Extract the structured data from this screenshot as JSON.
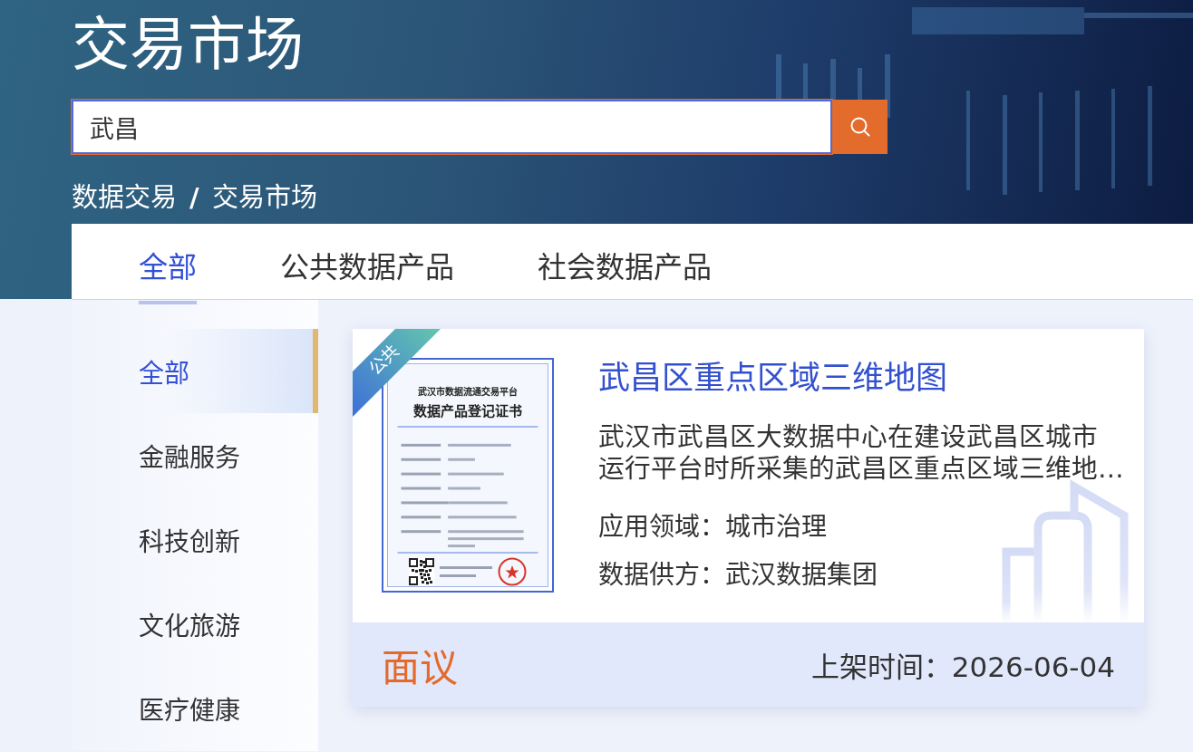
{
  "header": {
    "title": "交易市场",
    "search": {
      "value": "武昌"
    },
    "breadcrumb": {
      "items": [
        "数据交易",
        "交易市场"
      ],
      "separator": "/"
    }
  },
  "tabs": [
    {
      "label": "全部",
      "selected": true
    },
    {
      "label": "公共数据产品",
      "selected": false
    },
    {
      "label": "社会数据产品",
      "selected": false
    }
  ],
  "sidebar": {
    "items": [
      {
        "label": "全部",
        "selected": true
      },
      {
        "label": "金融服务",
        "selected": false
      },
      {
        "label": "科技创新",
        "selected": false
      },
      {
        "label": "文化旅游",
        "selected": false
      },
      {
        "label": "医疗健康",
        "selected": false
      }
    ]
  },
  "products": [
    {
      "tag": "公共",
      "certificate": {
        "issuer": "武汉市数据流通交易平台",
        "title": "数据产品登记证书"
      },
      "title": "武昌区重点区域三维地图",
      "description": "武汉市武昌区大数据中心在建设武昌区城市运行平台时所采集的武昌区重点区域三维地…",
      "fields": [
        {
          "label": "应用领域：",
          "value": "城市治理"
        },
        {
          "label": "数据供方：",
          "value": "武汉数据集团"
        }
      ],
      "price": "面议",
      "listed": {
        "label": "上架时间：",
        "value": "2026-06-04"
      }
    }
  ]
}
